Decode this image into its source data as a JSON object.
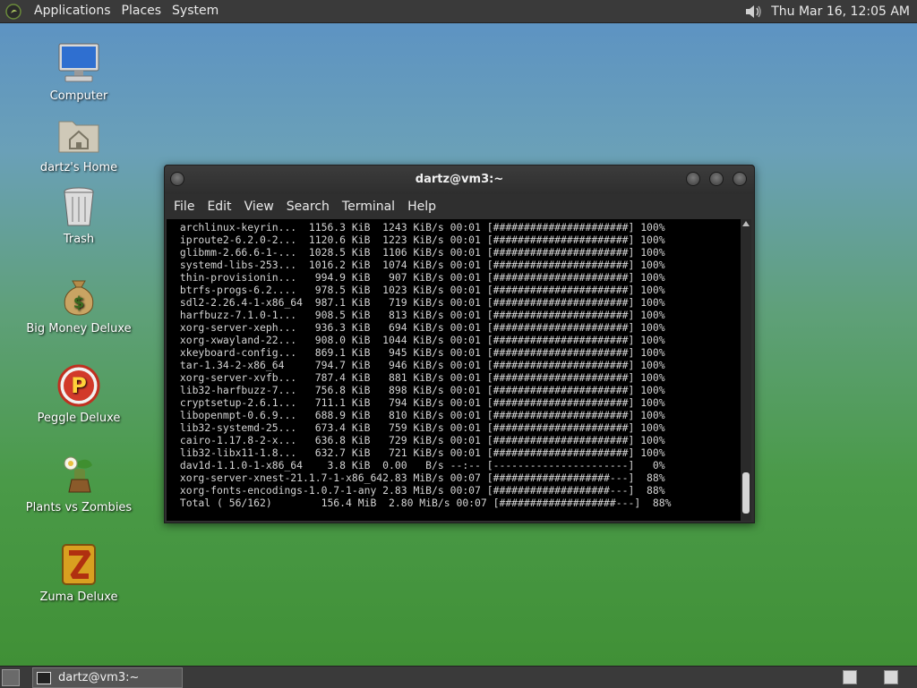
{
  "top_panel": {
    "menus": [
      "Applications",
      "Places",
      "System"
    ],
    "clock": "Thu Mar 16, 12:05 AM",
    "icons": {
      "logo": "gnome-foot-icon",
      "volume": "volume-icon"
    }
  },
  "desktop_icons": [
    {
      "label": "Computer",
      "icon": "computer-icon"
    },
    {
      "label": "dartz's Home",
      "icon": "home-folder-icon"
    },
    {
      "label": "Trash",
      "icon": "trash-icon"
    },
    {
      "label": "Big Money Deluxe",
      "icon": "money-bag-icon"
    },
    {
      "label": "Peggle Deluxe",
      "icon": "peggle-icon"
    },
    {
      "label": "Plants vs Zombies",
      "icon": "plants-icon"
    },
    {
      "label": "Zuma Deluxe",
      "icon": "zuma-icon"
    }
  ],
  "window": {
    "title": "dartz@vm3:~",
    "menus": [
      "File",
      "Edit",
      "View",
      "Search",
      "Terminal",
      "Help"
    ],
    "terminal_lines": [
      " archlinux-keyrin...  1156.3 KiB  1243 KiB/s 00:01 [######################] 100%",
      " iproute2-6.2.0-2...  1120.6 KiB  1223 KiB/s 00:01 [######################] 100%",
      " glibmm-2.66.6-1-...  1028.5 KiB  1106 KiB/s 00:01 [######################] 100%",
      " systemd-libs-253...  1016.2 KiB  1074 KiB/s 00:01 [######################] 100%",
      " thin-provisionin...   994.9 KiB   907 KiB/s 00:01 [######################] 100%",
      " btrfs-progs-6.2....   978.5 KiB  1023 KiB/s 00:01 [######################] 100%",
      " sdl2-2.26.4-1-x86_64  987.1 KiB   719 KiB/s 00:01 [######################] 100%",
      " harfbuzz-7.1.0-1...   908.5 KiB   813 KiB/s 00:01 [######################] 100%",
      " xorg-server-xeph...   936.3 KiB   694 KiB/s 00:01 [######################] 100%",
      " xorg-xwayland-22...   908.0 KiB  1044 KiB/s 00:01 [######################] 100%",
      " xkeyboard-config...   869.1 KiB   945 KiB/s 00:01 [######################] 100%",
      " tar-1.34-2-x86_64     794.7 KiB   946 KiB/s 00:01 [######################] 100%",
      " xorg-server-xvfb...   787.4 KiB   881 KiB/s 00:01 [######################] 100%",
      " lib32-harfbuzz-7...   756.8 KiB   898 KiB/s 00:01 [######################] 100%",
      " cryptsetup-2.6.1...   711.1 KiB   794 KiB/s 00:01 [######################] 100%",
      " libopenmpt-0.6.9...   688.9 KiB   810 KiB/s 00:01 [######################] 100%",
      " lib32-systemd-25...   673.4 KiB   759 KiB/s 00:01 [######################] 100%",
      " cairo-1.17.8-2-x...   636.8 KiB   729 KiB/s 00:01 [######################] 100%",
      " lib32-libx11-1.8...   632.7 KiB   721 KiB/s 00:01 [######################] 100%",
      " dav1d-1.1.0-1-x86_64    3.8 KiB  0.00   B/s --:-- [----------------------]   0%",
      " xorg-server-xnest-21.1.7-1-x86_642.83 MiB/s 00:07 [###################---]  88%",
      " xorg-fonts-encodings-1.0.7-1-any 2.83 MiB/s 00:07 [###################---]  88%",
      " Total ( 56/162)        156.4 MiB  2.80 MiB/s 00:07 [###################---]  88%"
    ]
  },
  "taskbar": {
    "task_label": "dartz@vm3:~"
  }
}
